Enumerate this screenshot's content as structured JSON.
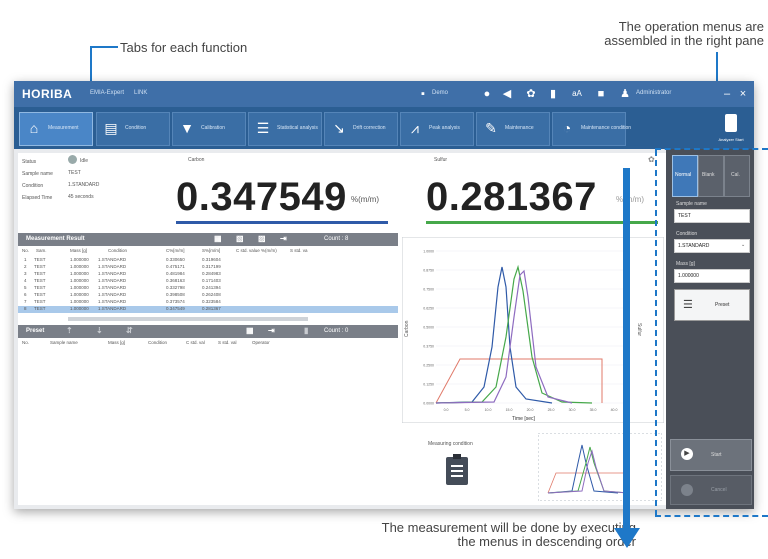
{
  "annotations": {
    "tabs_note": "Tabs for each function",
    "menus_note_line1": "The operation menus are",
    "menus_note_line2": "assembled in the right pane",
    "order_note_line1": "The measurement will be done by executing",
    "order_note_line2": "the menus in descending order"
  },
  "app": {
    "brand": "HORIBA",
    "titlebar_items": [
      "EMIA-Expert",
      "LINK"
    ],
    "user_label": "Demo",
    "admin_label": "Administrator"
  },
  "tabs": [
    {
      "label": "Measurement",
      "icon": "home-icon",
      "active": true
    },
    {
      "label": "Condition",
      "icon": "document-icon"
    },
    {
      "label": "Calibration",
      "icon": "flask-icon"
    },
    {
      "label": "Statistical analysis",
      "icon": "list-icon"
    },
    {
      "label": "Drift correction",
      "icon": "chart-icon"
    },
    {
      "label": "Peak analysis",
      "icon": "peak-icon"
    },
    {
      "label": "Maintenance",
      "icon": "wrench-icon"
    },
    {
      "label": "Maintenance condition",
      "icon": "gauge-icon"
    }
  ],
  "status_panel": {
    "status_label": "Status",
    "status_value": "Idle",
    "sample_label": "Sample name",
    "sample_value": "TEST",
    "condition_label": "Condition",
    "condition_value": "1.STANDARD",
    "elapsed_label": "Elapsed Time",
    "elapsed_value": "45 seconds"
  },
  "results": {
    "carbon_label": "Carbon",
    "carbon_value": "0.347549",
    "carbon_unit": "%(m/m)",
    "sulfur_label": "Sulfur",
    "sulfur_value": "0.281367",
    "sulfur_unit": "%(m/m)"
  },
  "measurement_table": {
    "title": "Measurement Result",
    "columns": [
      "No.",
      "Sam.",
      "Mass [g]",
      "Condition",
      "C%[m/m]",
      "S%[m/m]",
      "C std. value %(m/m)",
      "S std. va"
    ],
    "rows": [
      [
        "1",
        "TEST",
        "1.000000",
        "1.STANDARD",
        "0.330650",
        "0.319604"
      ],
      [
        "2",
        "TEST",
        "1.000000",
        "1.STANDARD",
        "0.475171",
        "0.317199"
      ],
      [
        "3",
        "TEST",
        "1.000000",
        "1.STANDARD",
        "0.481984",
        "0.284983"
      ],
      [
        "4",
        "TEST",
        "1.000000",
        "1.STANDARD",
        "0.368163",
        "0.171403"
      ],
      [
        "5",
        "TEST",
        "1.000000",
        "1.STANDARD",
        "0.332798",
        "0.241394"
      ],
      [
        "6",
        "TEST",
        "1.000000",
        "1.STANDARD",
        "0.398508",
        "0.262408"
      ],
      [
        "7",
        "TEST",
        "1.000000",
        "1.STANDARD",
        "0.373574",
        "0.323584"
      ],
      [
        "8",
        "TEST",
        "1.000000",
        "1.STANDARD",
        "0.347549",
        "0.281367"
      ]
    ],
    "count_label": "Count : 8"
  },
  "preset_table": {
    "title": "Preset",
    "columns": [
      "No.",
      "Sample name",
      "Mass [g]",
      "Condition",
      "C std. val",
      "S std. val",
      "Operator"
    ],
    "count_label": "Count : 0"
  },
  "graph": {
    "ylabel": "Carbon",
    "y2label": "Sulfur",
    "xlabel": "Time [sec]",
    "x_ticks": [
      "0.0",
      "5.0",
      "10.0",
      "15.0",
      "20.0",
      "25.0",
      "30.0",
      "35.0",
      "40.0"
    ],
    "y_ticks": [
      "1.0000",
      "0.8750",
      "0.7500",
      "0.6250",
      "0.5000",
      "0.3750",
      "0.2500",
      "0.1250",
      "0.0000"
    ]
  },
  "thumbnail": {
    "label": "Measuring condition"
  },
  "right_pane": {
    "tabs": [
      "Normal",
      "Blank",
      "Cal."
    ],
    "sample_label": "Sample name",
    "sample_value": "TEST",
    "condition_label": "Condition",
    "condition_value": "1.STANDARD",
    "mass_label": "Mass [g]",
    "mass_value": "1.000000",
    "preset_label": "Preset",
    "start_label": "Start",
    "stop_label": "Cancel",
    "corner_label": "Analyzer Start"
  },
  "colors": {
    "accent": "#1e78c8",
    "carbon_line": "#2f5aa8",
    "sulfur_line": "#46a84a"
  }
}
